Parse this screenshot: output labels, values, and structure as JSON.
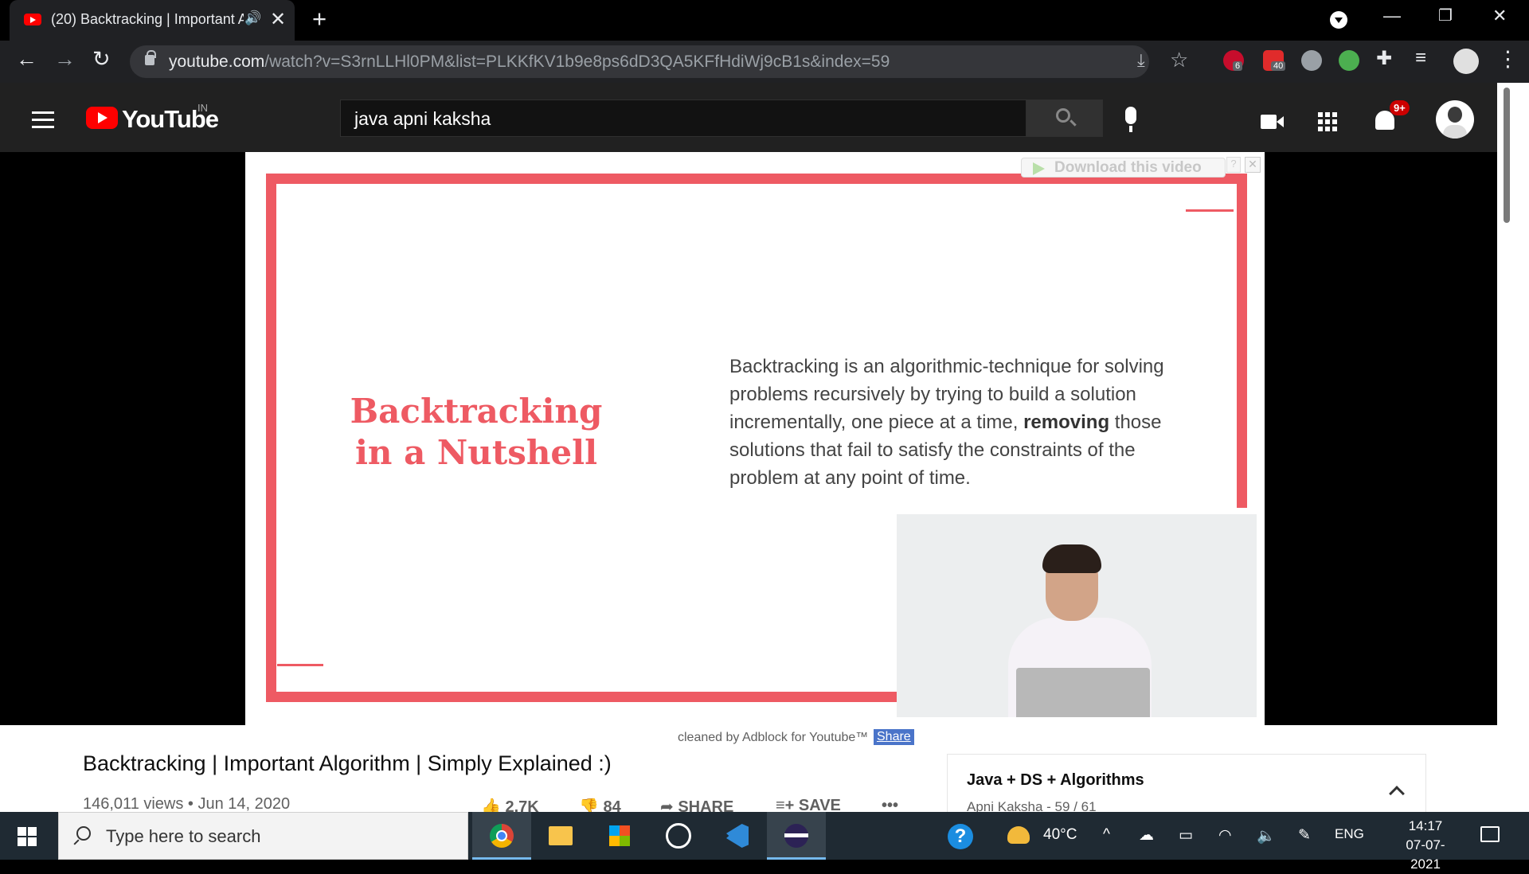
{
  "browser": {
    "tab_title": "(20) Backtracking | Important Algorithm | Simply Explained :)",
    "tab_audio_icon": "speaker-icon",
    "url_host": "youtube.com",
    "url_path": "/watch?v=S3rnLLHl0PM&list=PLKKfKV1b9e8ps6dD3QA5KFfHdiWj9cB1s&index=59",
    "extensions": [
      {
        "name": "abp",
        "badge": "6",
        "color": "#c70d2c"
      },
      {
        "name": "video-downloader",
        "badge": "40",
        "color": "#e02b2b"
      },
      {
        "name": "extension-cloud",
        "badge": "",
        "color": "#9aa0a6"
      },
      {
        "name": "extension-color",
        "badge": "",
        "color": "#4caf50"
      }
    ]
  },
  "youtube": {
    "wordmark": "YouTube",
    "country": "IN",
    "search_query": "java apni kaksha",
    "notifications_badge": "9+",
    "brand_red": "#ff0000"
  },
  "video": {
    "slide_heading": "Backtracking in a Nutshell",
    "slide_body_1": "Backtracking is an algorithmic-technique for solving problems recursively by trying to build a solution incrementally, one piece at a time, ",
    "slide_body_bold": "removing",
    "slide_body_2": " those solutions that fail to satisfy the constraints of the problem at any point of time.",
    "accent_color": "#ee5a63",
    "download_label": "Download this video",
    "download_help": "?",
    "download_close": "✕"
  },
  "below_player": {
    "adblock_note": "cleaned by Adblock for Youtube™",
    "adblock_share": "Share",
    "title": "Backtracking | Important Algorithm | Simply Explained :)",
    "views_date": "146,011 views • Jun 14, 2020",
    "likes": "2.7K",
    "dislikes": "84",
    "share": "SHARE",
    "save": "SAVE",
    "more": "•••"
  },
  "playlist": {
    "title": "Java + DS + Algorithms",
    "meta": "Apni Kaksha - 59 / 61"
  },
  "taskbar": {
    "search_placeholder": "Type here to search",
    "temperature": "40°C",
    "language": "ENG",
    "time": "14:17",
    "date": "07-07-2021"
  }
}
